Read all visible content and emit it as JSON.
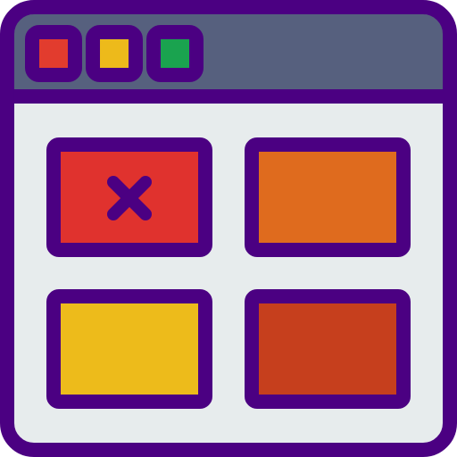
{
  "icon": {
    "name": "browser-window-grid-error-icon",
    "colors": {
      "outline": "#4b0082",
      "titlebar": "#56607e",
      "window_body": "#e7eced",
      "dot_red": "#e23c2e",
      "dot_yellow": "#edba1b",
      "dot_green": "#1aa34f",
      "tile_red": "#e0322e",
      "tile_orange": "#df6b1e",
      "tile_yellow": "#edbb1b",
      "tile_rust": "#c63f1d",
      "x_mark": "#4b0082"
    },
    "window_controls": [
      "red-dot",
      "yellow-dot",
      "green-dot"
    ],
    "tiles": [
      {
        "name": "tile-top-left",
        "color_key": "tile_red",
        "has_close_mark": true
      },
      {
        "name": "tile-top-right",
        "color_key": "tile_orange",
        "has_close_mark": false
      },
      {
        "name": "tile-bottom-left",
        "color_key": "tile_yellow",
        "has_close_mark": false
      },
      {
        "name": "tile-bottom-right",
        "color_key": "tile_rust",
        "has_close_mark": false
      }
    ]
  }
}
